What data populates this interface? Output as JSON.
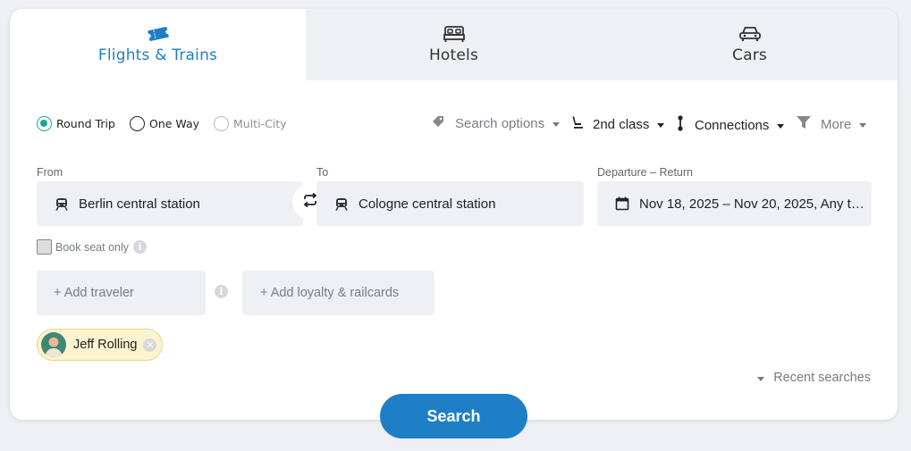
{
  "tabs": [
    {
      "label": "Flights & Trains",
      "icon": "ticket-icon",
      "active": true
    },
    {
      "label": "Hotels",
      "icon": "bed-icon",
      "active": false
    },
    {
      "label": "Cars",
      "icon": "car-icon",
      "active": false
    }
  ],
  "trip_types": [
    {
      "label": "Round Trip",
      "checked": true
    },
    {
      "label": "One Way",
      "checked": false
    },
    {
      "label": "Multi-City",
      "checked": false,
      "disabled": true
    }
  ],
  "options": {
    "search_options": "Search options",
    "class": "2nd class",
    "connections": "Connections",
    "more": "More"
  },
  "form": {
    "from_label": "From",
    "from_value": "Berlin central station",
    "to_label": "To",
    "to_value": "Cologne central station",
    "dates_label": "Departure – Return",
    "dates_value": "Nov 18, 2025 – Nov 20, 2025, Any t…"
  },
  "book_seat_only": "Book seat only",
  "add_traveler": "+ Add traveler",
  "add_loyalty": "+ Add loyalty & railcards",
  "traveler": {
    "name": "Jeff Rolling"
  },
  "recent_searches": "Recent searches",
  "search_button": "Search",
  "colors": {
    "accent": "#1e7fc6",
    "radio": "#1ca69a",
    "chip_bg": "#fcf3cf"
  }
}
